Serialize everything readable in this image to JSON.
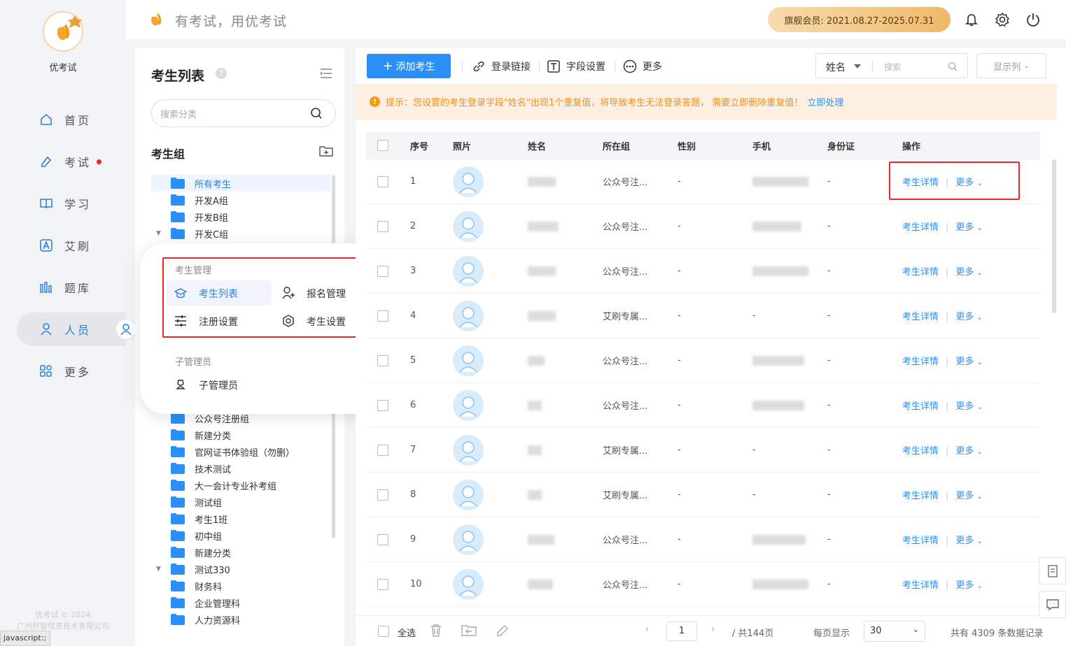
{
  "brand": {
    "name": "优考试",
    "slogan": "有考试，用优考试",
    "footer_line1": "优考试 © 2024",
    "footer_line2": "广州好智信息技术有限公司"
  },
  "member": {
    "label": "旗舰会员: 2021.08.27-2025.07.31"
  },
  "nav": [
    {
      "label": "首页",
      "icon": "home-icon"
    },
    {
      "label": "考试",
      "icon": "exam-icon",
      "dot": true
    },
    {
      "label": "学习",
      "icon": "book-icon"
    },
    {
      "label": "艾刷",
      "icon": "a-icon"
    },
    {
      "label": "题库",
      "icon": "bank-icon"
    },
    {
      "label": "人员",
      "icon": "user-icon",
      "active": true
    },
    {
      "label": "更多",
      "icon": "apps-icon"
    }
  ],
  "left": {
    "title": "考生列表",
    "search_placeholder": "搜索分类",
    "group_title": "考生组",
    "tree_top": [
      "所有考生",
      "开发A组",
      "开发B组",
      "开发C组"
    ],
    "tree_bottom": [
      "公众号注册组",
      "新建分类",
      "官网证书体验组（勿删）",
      "技术测试",
      "大一会计专业补考组",
      "测试组",
      "考生1班",
      "初中组",
      "新建分类",
      "测试330",
      "财务科",
      "企业管理科",
      "人力资源科"
    ]
  },
  "popup": {
    "section1": "考生管理",
    "items": [
      "考生列表",
      "报名管理",
      "注册设置",
      "考生设置"
    ],
    "section2": "子管理员",
    "sub": "子管理员"
  },
  "toolbar": {
    "add": "添加考生",
    "login_link": "登录链接",
    "field_settings": "字段设置",
    "more": "更多",
    "select": "姓名",
    "search_placeholder": "搜索",
    "columns": "显示列"
  },
  "notice": {
    "text": "提示：您设置的考生登录字段\"姓名\"出现1个重复值，将导致考生无法登录答题， 需要立即删除重复值！",
    "action": "立即处理"
  },
  "table": {
    "headers": [
      "序号",
      "照片",
      "姓名",
      "所在组",
      "性别",
      "手机",
      "身份证",
      "操作"
    ],
    "action_detail": "考生详情",
    "action_more": "更多",
    "rows": [
      {
        "no": "1",
        "group": "公众号注...",
        "gender": "-",
        "phone": "blur",
        "id": "-"
      },
      {
        "no": "2",
        "group": "公众号注...",
        "gender": "-",
        "phone": "blur",
        "id": "-"
      },
      {
        "no": "3",
        "group": "公众号注...",
        "gender": "-",
        "phone": "blur",
        "id": "-"
      },
      {
        "no": "4",
        "group": "艾刷专属...",
        "gender": "-",
        "phone": "-",
        "id": "-"
      },
      {
        "no": "5",
        "group": "公众号注...",
        "gender": "-",
        "phone": "blur",
        "id": "-"
      },
      {
        "no": "6",
        "group": "公众号注...",
        "gender": "-",
        "phone": "blur",
        "id": "-"
      },
      {
        "no": "7",
        "group": "艾刷专属...",
        "gender": "-",
        "phone": "-",
        "id": "-"
      },
      {
        "no": "8",
        "group": "艾刷专属...",
        "gender": "-",
        "phone": "-",
        "id": "-"
      },
      {
        "no": "9",
        "group": "公众号注...",
        "gender": "-",
        "phone": "blur",
        "id": "-"
      },
      {
        "no": "10",
        "group": "公众号注...",
        "gender": "-",
        "phone": "blur",
        "id": "-"
      }
    ]
  },
  "footer": {
    "select_all": "全选",
    "page": "1",
    "total_pages": "/ 共144页",
    "per_page_label": "每页显示",
    "per_page": "30",
    "total": "共有 4309 条数据记录"
  },
  "status": "javascript:;"
}
